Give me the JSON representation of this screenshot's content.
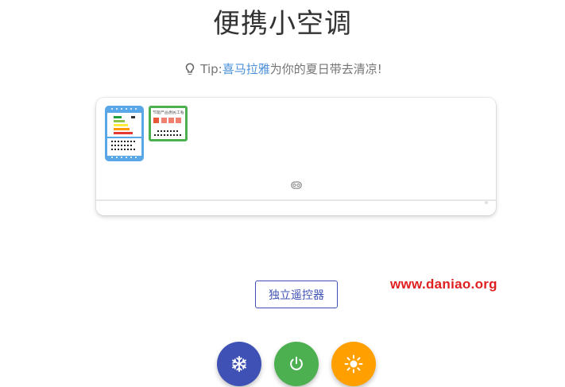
{
  "title": "便携小空调",
  "tip": {
    "prefix": "Tip:",
    "link": "喜马拉雅",
    "suffix": "为你的夏日带去清凉!"
  },
  "ac": {
    "energy_label_icon": "energy-efficiency-label-icon",
    "cert_label_title": "节能产品惠民工程",
    "display_icon": "display-indicator-icon"
  },
  "remote_button_label": "独立遥控器",
  "watermark": "www.daniao.org",
  "buttons": {
    "cool": {
      "icon": "snowflake-icon",
      "color": "#3f51b5"
    },
    "power": {
      "icon": "power-icon",
      "color": "#4caf50"
    },
    "heat": {
      "icon": "sun-icon",
      "color": "#ffa000"
    }
  }
}
